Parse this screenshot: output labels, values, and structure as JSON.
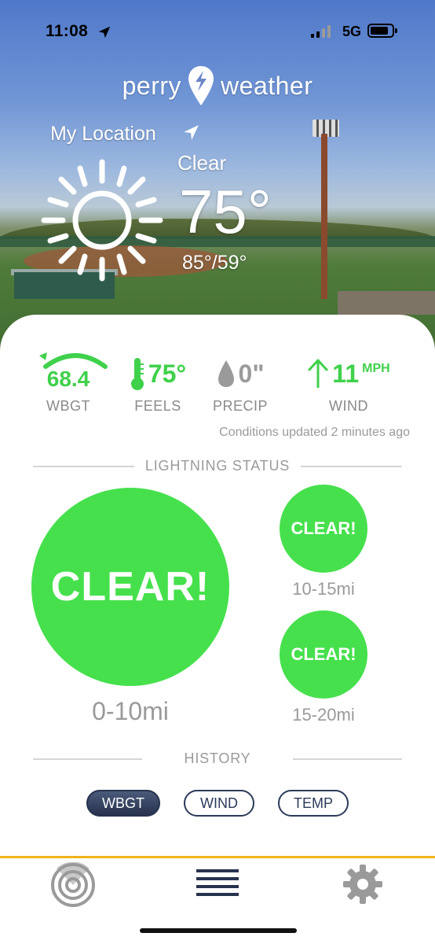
{
  "status_bar": {
    "time": "11:08",
    "network": "5G"
  },
  "brand": {
    "left": "perry",
    "right": "weather"
  },
  "current": {
    "location": "My Location",
    "condition": "Clear",
    "temp": "75°",
    "hilo": "85°/59°"
  },
  "metrics": [
    {
      "value": "68.4",
      "label": "WBGT"
    },
    {
      "value": "75°",
      "label": "FEELS"
    },
    {
      "value": "0\"",
      "label": "PRECIP"
    },
    {
      "value": "11",
      "unit": "MPH",
      "label": "WIND"
    }
  ],
  "updated_text": "Conditions updated 2 minutes ago",
  "lightning": {
    "header": "LIGHTNING STATUS",
    "zones": [
      {
        "status": "CLEAR!",
        "range": "0-10mi"
      },
      {
        "status": "CLEAR!",
        "range": "10-15mi"
      },
      {
        "status": "CLEAR!",
        "range": "15-20mi"
      }
    ]
  },
  "history": {
    "header": "HISTORY",
    "tabs": [
      {
        "label": "WBGT",
        "active": true
      },
      {
        "label": "WIND",
        "active": false
      },
      {
        "label": "TEMP",
        "active": false
      }
    ]
  },
  "colors": {
    "accent_green": "#3fd14b",
    "circle_green": "#46e04d",
    "tab_accent": "#f2b21b",
    "navy": "#27334e"
  },
  "icons": {
    "tabbar": [
      "radar-icon",
      "menu-icon",
      "gear-icon"
    ]
  }
}
